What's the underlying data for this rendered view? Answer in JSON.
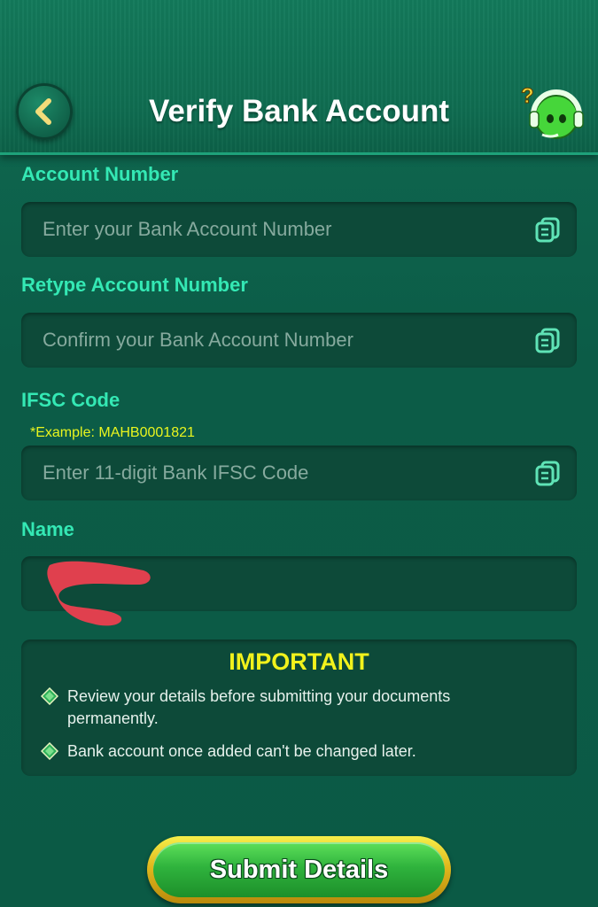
{
  "header": {
    "title": "Verify Bank Account",
    "back_icon": "chevron-left-icon",
    "support_icon": "support-headset-icon"
  },
  "form": {
    "account_number": {
      "label": "Account Number",
      "placeholder": "Enter your Bank Account Number",
      "value": ""
    },
    "retype_account_number": {
      "label": "Retype Account Number",
      "placeholder": "Confirm your Bank Account Number",
      "value": ""
    },
    "ifsc": {
      "label": "IFSC Code",
      "hint": "*Example: MAHB0001821",
      "placeholder": "Enter 11-digit Bank IFSC Code",
      "value": ""
    },
    "name": {
      "label": "Name",
      "value": ""
    }
  },
  "important": {
    "title": "IMPORTANT",
    "items": [
      "Review your details before submitting your documents permanently.",
      "Bank account once added can't be changed later."
    ]
  },
  "submit_label": "Submit Details",
  "colors": {
    "background": "#0b5a45",
    "label": "#34e8b4",
    "hint": "#e9f51f",
    "important_title": "#f2f21c",
    "button_green": "#2fb33d",
    "button_gold": "#e0b81d"
  }
}
